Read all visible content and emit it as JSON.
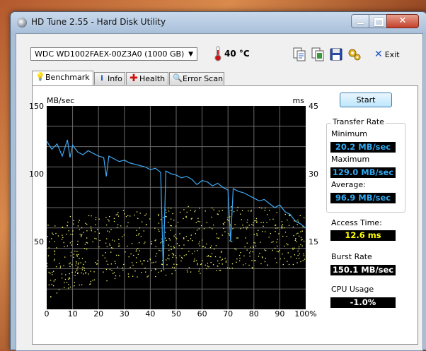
{
  "window": {
    "title": "HD Tune 2.55 - Hard Disk Utility"
  },
  "toolbar": {
    "drive": "WDC WD1002FAEX-00Z3A0 (1000 GB)",
    "temperature": "40 °C",
    "exit_label": "Exit",
    "icons": [
      "copy-text-icon",
      "copy-screenshot-icon",
      "save-icon",
      "options-icon"
    ]
  },
  "tabs": [
    {
      "label": "Benchmark",
      "icon": "lightbulb-icon",
      "active": true
    },
    {
      "label": "Info",
      "icon": "info-icon",
      "active": false
    },
    {
      "label": "Health",
      "icon": "health-cross-icon",
      "active": false
    },
    {
      "label": "Error Scan",
      "icon": "magnifier-icon",
      "active": false
    }
  ],
  "benchmark": {
    "start_label": "Start",
    "transfer_rate_label": "Transfer Rate",
    "minimum_label": "Minimum",
    "minimum_value": "20.2 MB/sec",
    "maximum_label": "Maximum",
    "maximum_value": "129.0 MB/sec",
    "average_label": "Average:",
    "average_value": "96.9 MB/sec",
    "access_time_label": "Access Time:",
    "access_time_value": "12.6 ms",
    "burst_rate_label": "Burst Rate",
    "burst_rate_value": "150.1 MB/sec",
    "cpu_usage_label": "CPU Usage",
    "cpu_usage_value": "-1.0%"
  },
  "colors": {
    "transfer_line": "#3fa9f5",
    "access_dots": "#ffff66",
    "plot_bg": "#000000",
    "value_blue": "#2fa8f0",
    "value_yellow": "#ffff00"
  },
  "chart_data": {
    "type": "line",
    "ylabel_left": "MB/sec",
    "ylabel_right": "ms",
    "xlim": [
      0,
      100
    ],
    "ylim_left": [
      0,
      150
    ],
    "ylim_right": [
      0,
      45
    ],
    "yticks_left": [
      "150",
      "100",
      "50"
    ],
    "yticks_right": [
      "45",
      "30",
      "15"
    ],
    "xticks": [
      "0",
      "10",
      "20",
      "30",
      "40",
      "50",
      "60",
      "70",
      "80",
      "90",
      "100%"
    ],
    "grid": true,
    "series": [
      {
        "kind": "transfer_rate",
        "x": [
          0,
          2,
          4,
          6,
          8,
          9,
          10,
          12,
          14,
          16,
          18,
          20,
          22,
          23,
          24,
          26,
          28,
          30,
          32,
          34,
          36,
          38,
          40,
          42,
          44,
          45,
          46,
          48,
          50,
          52,
          54,
          56,
          58,
          60,
          62,
          64,
          66,
          68,
          70,
          71,
          72,
          74,
          76,
          78,
          80,
          82,
          84,
          86,
          88,
          90,
          92,
          94,
          96,
          98,
          100
        ],
        "values": [
          124,
          118,
          122,
          113,
          125,
          112,
          121,
          116,
          114,
          117,
          115,
          113,
          112,
          98,
          113,
          111,
          109,
          110,
          108,
          107,
          106,
          105,
          103,
          104,
          101,
          30,
          102,
          100,
          99,
          97,
          98,
          96,
          92,
          95,
          94,
          91,
          93,
          90,
          88,
          50,
          89,
          87,
          86,
          84,
          82,
          80,
          81,
          78,
          75,
          77,
          72,
          70,
          65,
          63,
          60
        ]
      },
      {
        "kind": "access_time_scatter",
        "unit": "ms",
        "range_low": [
          2,
          5,
          6,
          7,
          7,
          8,
          8,
          9,
          9,
          10,
          10,
          11
        ],
        "range_high": [
          19,
          21,
          21,
          22,
          22,
          23,
          23,
          23,
          23,
          22,
          21,
          21
        ],
        "x_centers": [
          0,
          10,
          20,
          30,
          40,
          50,
          60,
          70,
          80,
          90,
          95,
          100
        ]
      }
    ]
  }
}
